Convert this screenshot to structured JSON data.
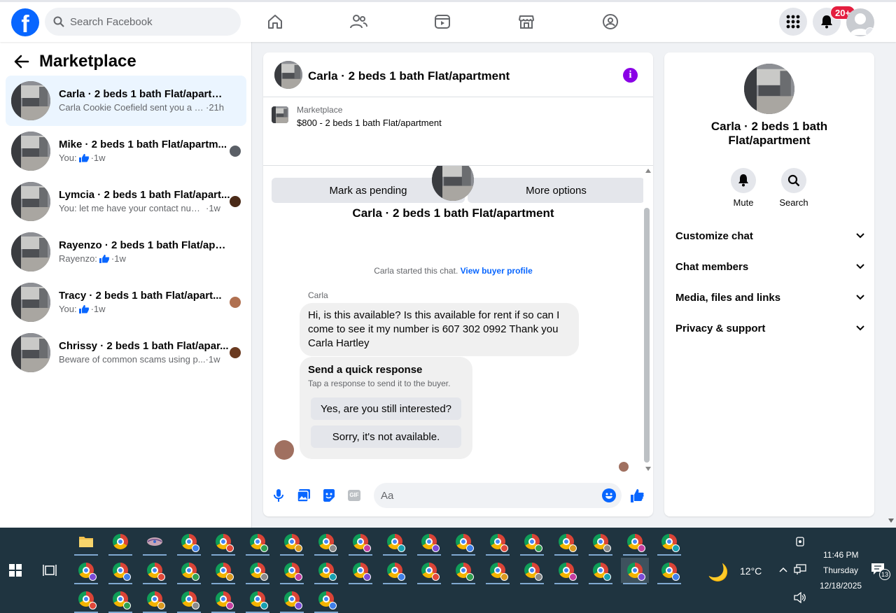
{
  "topbar": {
    "search_placeholder": "Search Facebook",
    "notifications_badge": "20+"
  },
  "sidebar": {
    "title": "Marketplace",
    "conversations": [
      {
        "title": "Carla · 2 beds 1 bath Flat/apartment",
        "preview": "Carla Cookie Coefield sent you a me...",
        "time": "·21h",
        "active": true
      },
      {
        "title": "Mike · 2 beds 1 bath Flat/apartm...",
        "preview": "You: ",
        "time": "·1w",
        "like": true
      },
      {
        "title": "Lymcia · 2 beds 1 bath Flat/apart...",
        "preview": "You: let me have your contact num...",
        "time": "·1w"
      },
      {
        "title": "Rayenzo · 2 beds 1 bath Flat/apart...",
        "preview": "Rayenzo: ",
        "time": "·1w",
        "like": true
      },
      {
        "title": "Tracy · 2 beds 1 bath Flat/apart...",
        "preview": "You: ",
        "time": "·1w",
        "like": true
      },
      {
        "title": "Chrissy · 2 beds 1 bath Flat/apar...",
        "preview": "Beware of common scams using p...",
        "time": "·1w"
      }
    ]
  },
  "chat": {
    "title": "Carla · 2 beds 1 bath Flat/apartment",
    "listing_category": "Marketplace",
    "listing_name": "$800 - 2 beds 1 bath Flat/apartment",
    "mark_pending_label": "Mark as pending",
    "more_options_label": "More options",
    "header_title": "Carla · 2 beds 1 bath Flat/apartment",
    "started_text": "Carla started this chat.",
    "view_buyer_label": "View buyer profile",
    "sender_name": "Carla",
    "message_text": "Hi, is this available? Is this available for rent if so can I come to see it my number is 607 302 0992 Thank you Carla Hartley",
    "quick_title": "Send a quick response",
    "quick_subtitle": "Tap a response to send it to the buyer.",
    "quick_replies": [
      "Yes, are you still interested?",
      "Sorry, it's not available."
    ],
    "composer_placeholder": "Aa",
    "gif_label": "GIF"
  },
  "details": {
    "title": "Carla · 2 beds 1 bath Flat/apartment",
    "mute_label": "Mute",
    "search_label": "Search",
    "sections": [
      "Customize chat",
      "Chat members",
      "Media, files and links",
      "Privacy & support"
    ]
  },
  "taskbar": {
    "weather_temp": "12°C",
    "time": "11:46 PM",
    "day": "Thursday",
    "date": "12/18/2025",
    "notification_count": "13"
  },
  "colors": {
    "accent": "#0866ff",
    "info_purple": "#8a00e6",
    "badge_red": "#e41e3f",
    "taskbar_bg": "#1f3440"
  }
}
